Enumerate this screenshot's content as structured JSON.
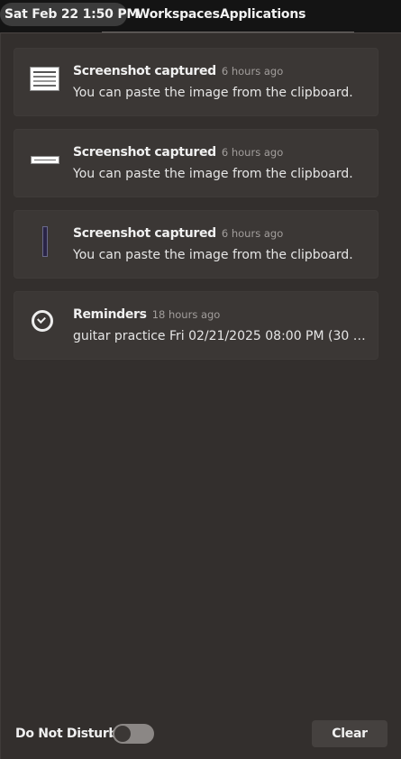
{
  "topbar": {
    "clock": "Sat Feb 22  1:50 PM",
    "workspaces_label": "Workspaces",
    "applications_label": "Applications"
  },
  "notifications": [
    {
      "title": "Screenshot captured",
      "time": "6 hours ago",
      "body": "You can paste the image from the clipboard.",
      "icon": "screenshot-thumbnail"
    },
    {
      "title": "Screenshot captured",
      "time": "6 hours ago",
      "body": "You can paste the image from the clipboard.",
      "icon": "screenshot-thumbnail"
    },
    {
      "title": "Screenshot captured",
      "time": "6 hours ago",
      "body": "You can paste the image from the clipboard.",
      "icon": "screenshot-thumbnail"
    },
    {
      "title": "Reminders",
      "time": "18 hours ago",
      "body": "guitar practice Fri 02/21/2025 08:00 PM (30 minu...",
      "icon": "clock-icon"
    }
  ],
  "footer": {
    "dnd_label": "Do Not Disturb",
    "dnd_enabled": false,
    "clear_label": "Clear"
  },
  "colors": {
    "panel_bg": "#332f2d",
    "card_bg": "#3b3735",
    "topbar_bg": "#141414"
  }
}
